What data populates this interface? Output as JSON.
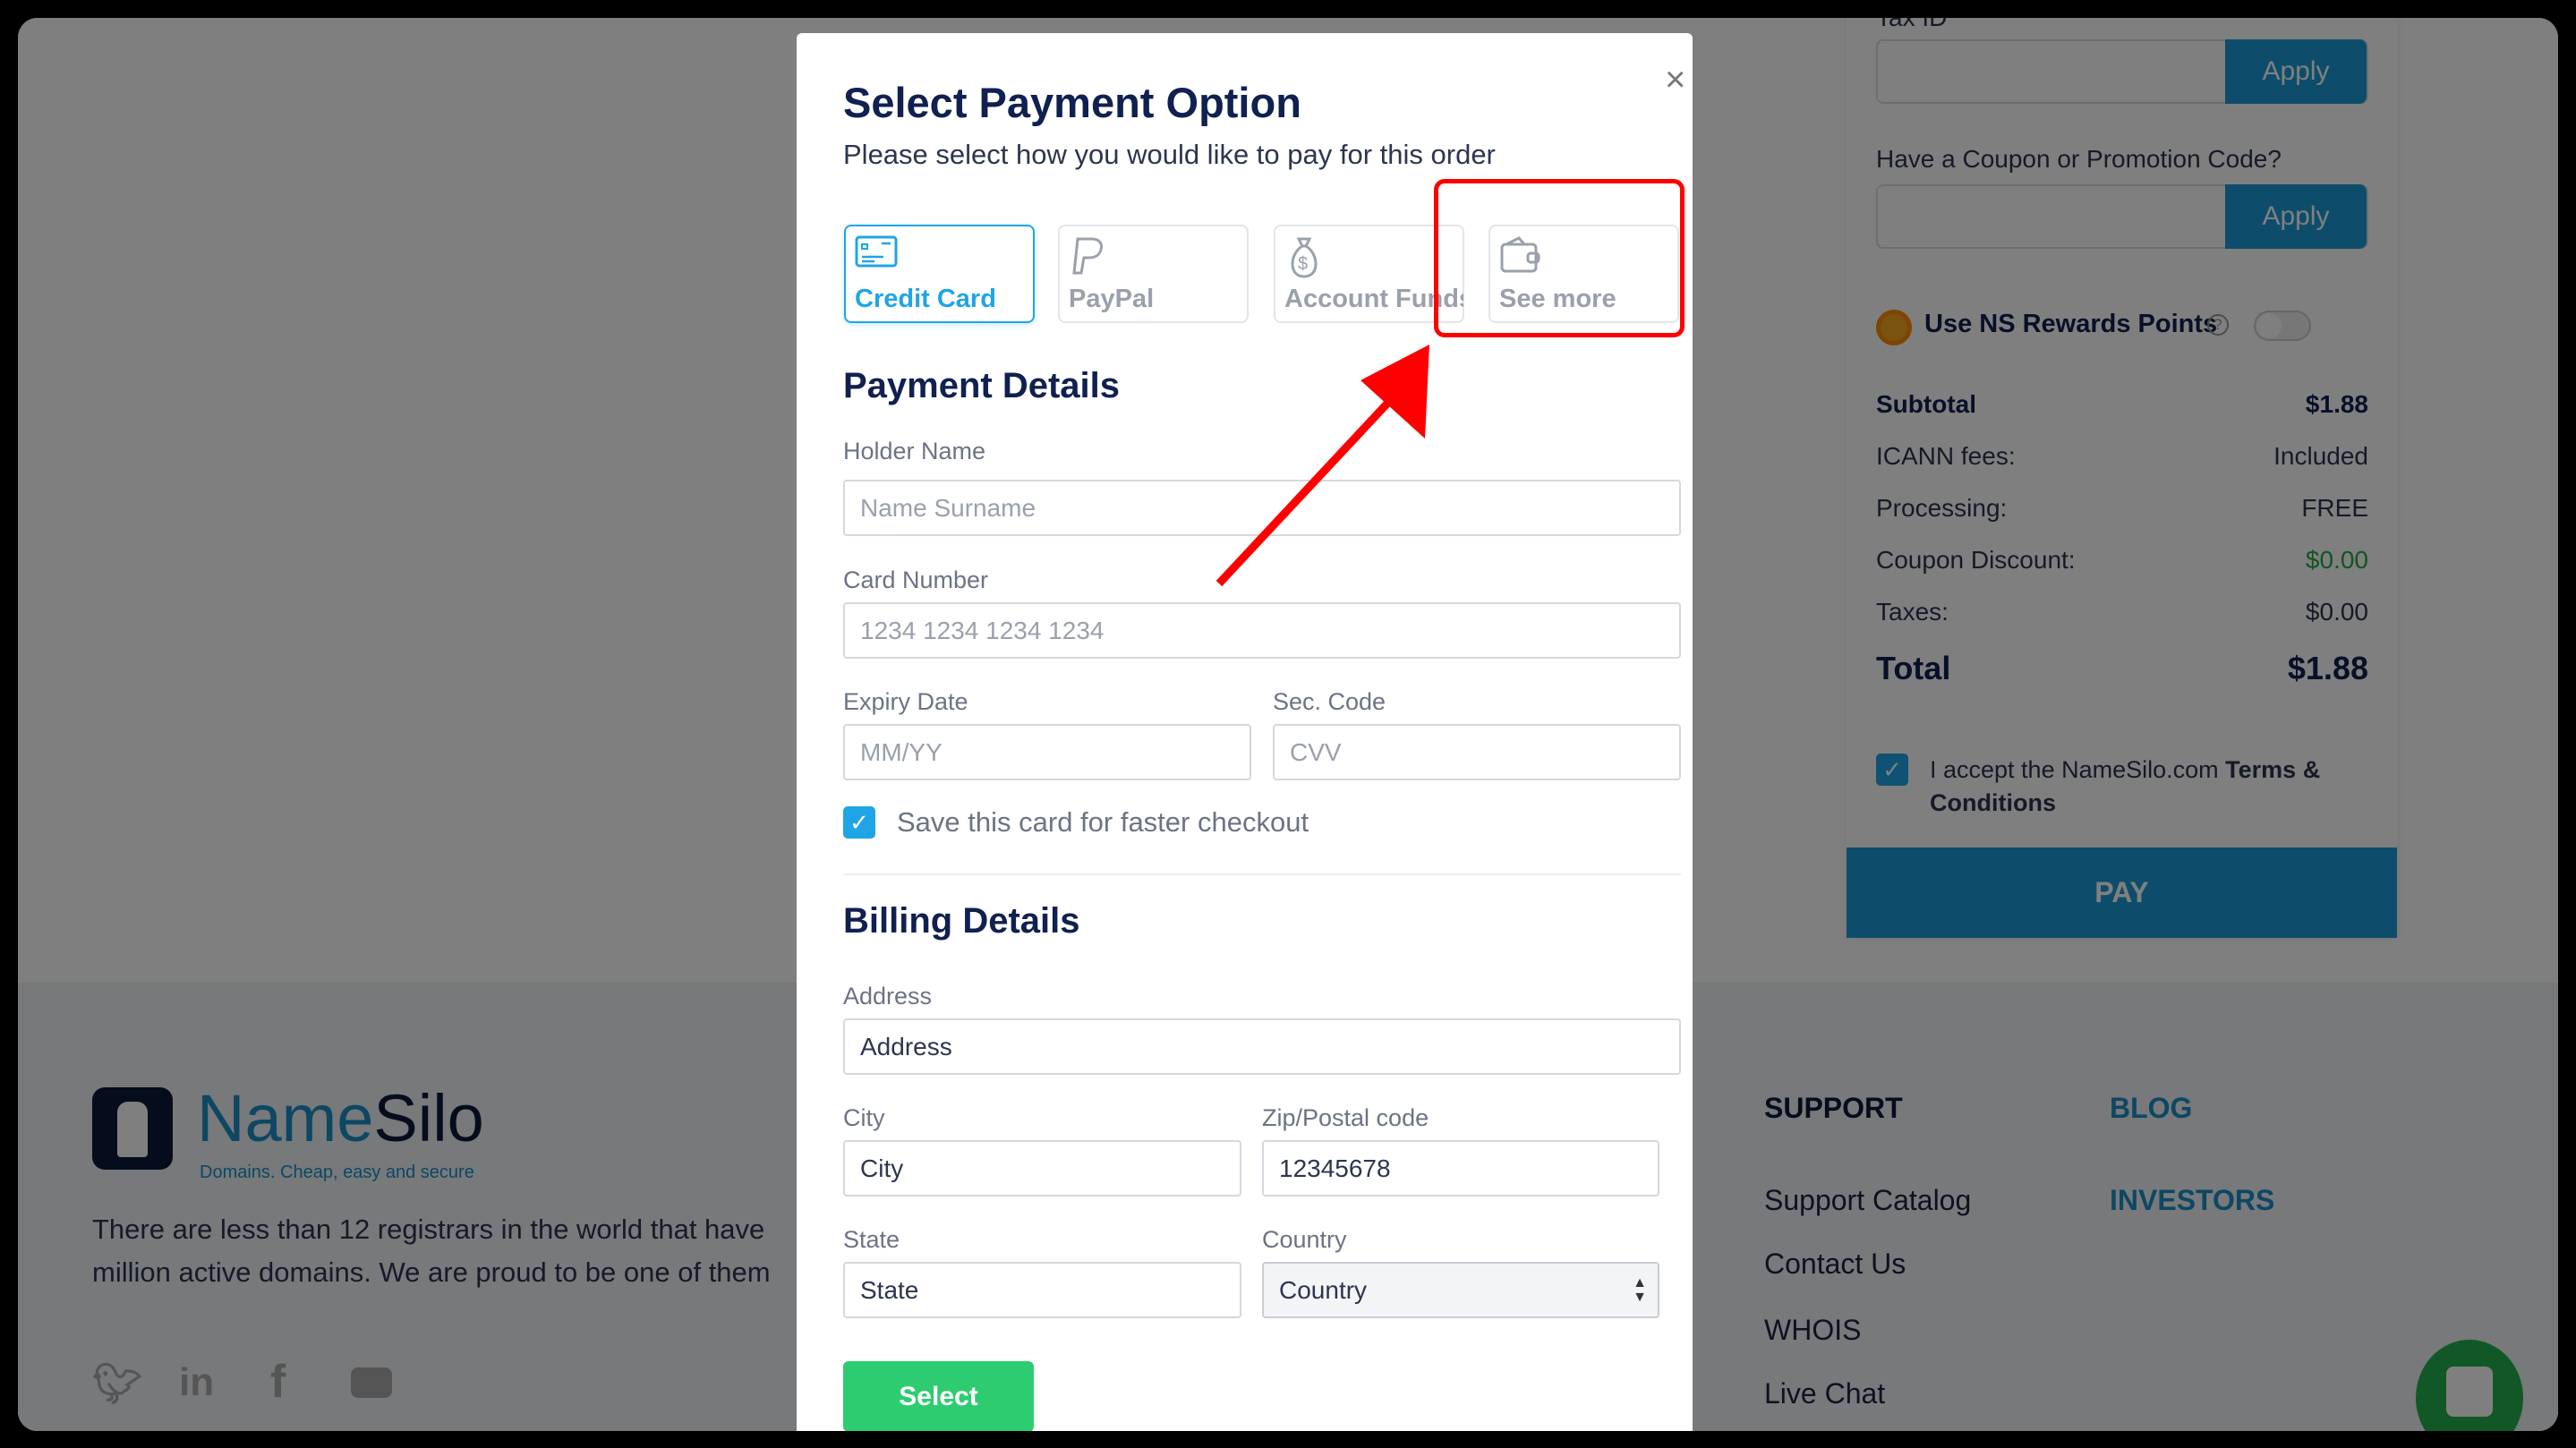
{
  "order_panel": {
    "tax_id_label": "Tax ID",
    "apply_label": "Apply",
    "coupon_label": "Have a Coupon or Promotion Code?",
    "rewards_label": "Use NS Rewards Points",
    "rewards_enabled": false,
    "summary": [
      {
        "label": "Subtotal",
        "value": "$1.88",
        "bold": true
      },
      {
        "label": "ICANN fees:",
        "value": "Included"
      },
      {
        "label": "Processing:",
        "value": "FREE"
      },
      {
        "label": "Coupon Discount:",
        "value": "$0.00",
        "color": "#27a844"
      },
      {
        "label": "Taxes:",
        "value": "$0.00"
      }
    ],
    "total_label": "Total",
    "total_value": "$1.88",
    "terms_prefix": "I accept the NameSilo.com ",
    "terms_link": "Terms & Conditions",
    "terms_checked": true,
    "pay_label": "PAY"
  },
  "footer": {
    "logo_name_a": "Name",
    "logo_name_b": "Silo",
    "logo_tagline": "Domains. Cheap, easy and secure",
    "about_line1": "There are less than 12 registrars in the world that have",
    "about_line2": "million active domains. We are proud to be one of them",
    "social_icons": [
      "twitter-icon",
      "linkedin-icon",
      "facebook-icon",
      "youtube-icon"
    ],
    "support_heading": "SUPPORT",
    "support_links": [
      "Support Catalog",
      "Contact Us",
      "WHOIS",
      "Live Chat"
    ],
    "blog": "BLOG",
    "investors": "INVESTORS"
  },
  "modal": {
    "title": "Select Payment Option",
    "subtitle": "Please select how you would like to pay for this order",
    "close": "×",
    "tabs": [
      {
        "label": "Credit Card",
        "icon": "credit-card-icon",
        "active": true
      },
      {
        "label": "PayPal",
        "icon": "paypal-icon"
      },
      {
        "label": "Account Funds",
        "icon": "money-bag-icon"
      },
      {
        "label": "See more",
        "icon": "wallet-icon"
      }
    ],
    "payment_heading": "Payment Details",
    "holder_label": "Holder Name",
    "holder_placeholder": "Name Surname",
    "card_label": "Card Number",
    "card_placeholder": "1234 1234 1234 1234",
    "expiry_label": "Expiry Date",
    "expiry_placeholder": "MM/YY",
    "sec_label": "Sec. Code",
    "sec_placeholder": "CVV",
    "save_card_label": "Save this card for faster checkout",
    "save_card_checked": true,
    "billing_heading": "Billing Details",
    "address_label": "Address",
    "address_value": "Address",
    "city_label": "City",
    "city_value": "City",
    "zip_label": "Zip/Postal code",
    "zip_value": "12345678",
    "state_label": "State",
    "state_value": "State",
    "country_label": "Country",
    "country_value": "Country",
    "select_label": "Select"
  },
  "colors": {
    "accent": "#1fa5e6",
    "select_button": "#2ecc71",
    "annotation": "#ff0000"
  }
}
